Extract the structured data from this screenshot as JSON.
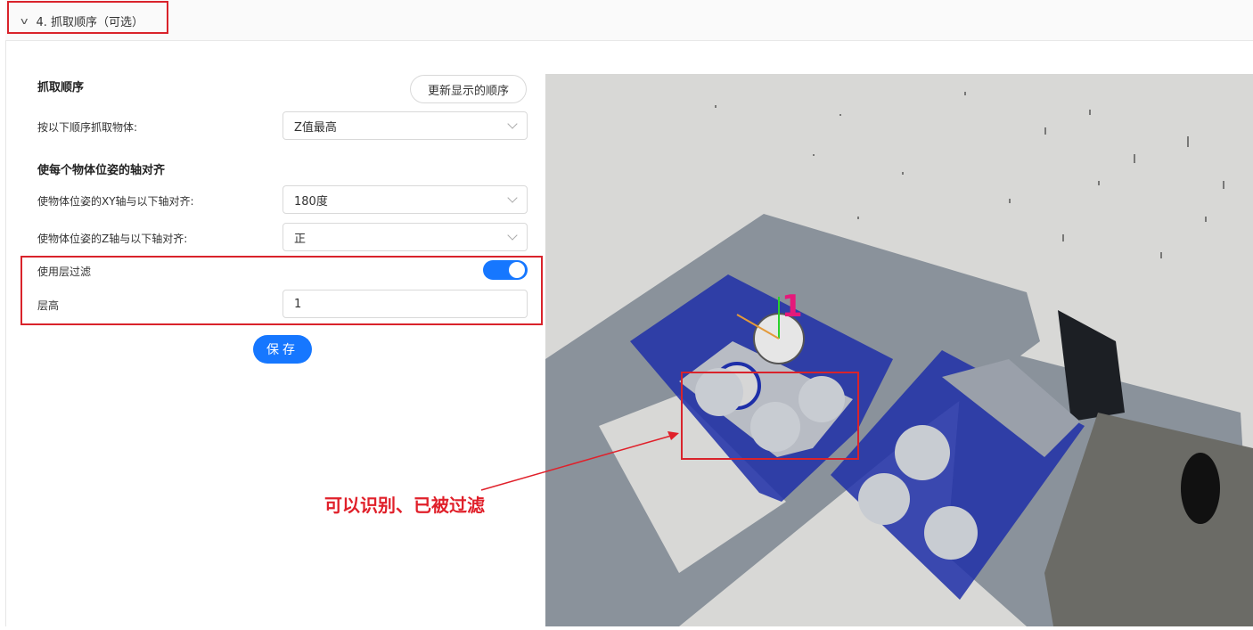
{
  "header": {
    "title": "4. 抓取顺序（可选）"
  },
  "grab_order": {
    "section_title": "抓取顺序",
    "update_button": "更新显示的顺序",
    "order_label": "按以下顺序抓取物体:",
    "order_value": "Z值最高"
  },
  "alignment": {
    "section_title": "使每个物体位姿的轴对齐",
    "xy_label": "使物体位姿的XY轴与以下轴对齐:",
    "xy_value": "180度",
    "z_label": "使物体位姿的Z轴与以下轴对齐:",
    "z_value": "正"
  },
  "layer_filter": {
    "label": "使用层过滤",
    "enabled": true,
    "height_label": "层高",
    "height_value": "1"
  },
  "save_button": "保存",
  "viewer": {
    "pick_index": "1"
  },
  "annotation": {
    "text": "可以识别、已被过滤"
  },
  "colors": {
    "accent": "#1677ff",
    "annotation_red": "#e0202a",
    "bin_blue": "#1e2fa8"
  },
  "icons": {
    "header_toggle": "chevron-down-icon",
    "select_caret": "chevron-down-icon"
  }
}
